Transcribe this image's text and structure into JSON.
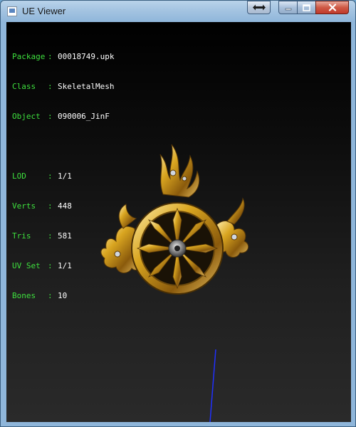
{
  "window": {
    "title": "UE Viewer",
    "buttons": {
      "resize_icon": "double-arrow-icon",
      "minimize_icon": "minimize-icon",
      "maximize_icon": "maximize-icon",
      "close_icon": "close-icon"
    }
  },
  "info": {
    "package": {
      "label": "Package",
      "sep": ":",
      "value": "00018749.upk"
    },
    "class": {
      "label": "Class",
      "sep": ":",
      "value": "SkeletalMesh"
    },
    "object": {
      "label": "Object",
      "sep": ":",
      "value": "090006_JinF"
    },
    "lod": {
      "label": "LOD",
      "sep": ":",
      "value": "1/1"
    },
    "verts": {
      "label": "Verts",
      "sep": ":",
      "value": "448"
    },
    "tris": {
      "label": "Tris",
      "sep": ":",
      "value": "581"
    },
    "uvset": {
      "label": "UV Set",
      "sep": ":",
      "value": "1/1"
    },
    "bones": {
      "label": "Bones",
      "sep": ":",
      "value": "10"
    }
  },
  "colors": {
    "label_green": "#3ee03e",
    "value_white": "#ffffff",
    "gold": "#d4a017",
    "axis_blue": "#2030ff"
  }
}
